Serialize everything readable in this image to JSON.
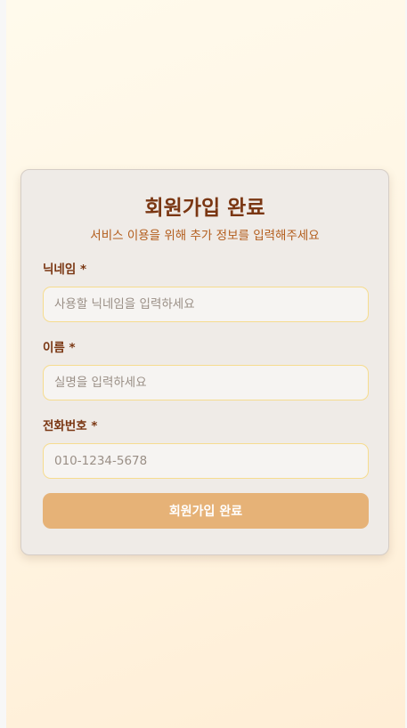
{
  "form": {
    "title": "회원가입 완료",
    "subtitle": "서비스 이용을 위해 추가 정보를 입력해주세요",
    "fields": [
      {
        "label": "닉네임 *",
        "value": "",
        "placeholder": "사용할 닉네임을 입력하세요"
      },
      {
        "label": "이름 *",
        "value": "",
        "placeholder": "실명을 입력하세요"
      },
      {
        "label": "전화번호 *",
        "value": "",
        "placeholder": "010-1234-5678"
      }
    ],
    "submit_label": "회원가입 완료"
  },
  "colors": {
    "title": "#7a3612",
    "subtitle": "#b35d1c",
    "card_background": "#efebe7",
    "input_border": "#f6dc8f",
    "button_background": "#e6b277",
    "button_text": "#ffffff"
  }
}
